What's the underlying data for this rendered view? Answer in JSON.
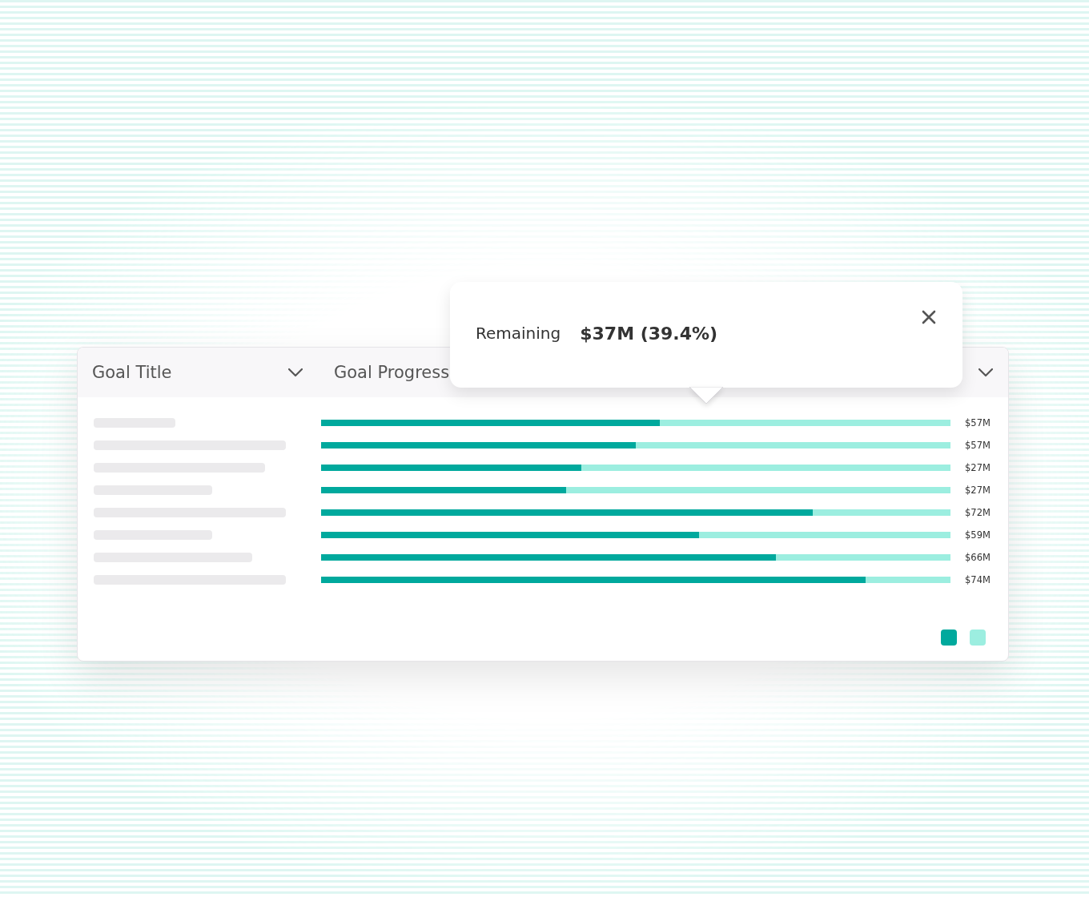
{
  "columns": [
    {
      "label": "Goal Title"
    },
    {
      "label": "Goal Progress"
    }
  ],
  "rows": [
    {
      "value": "$57M",
      "level": 0.538
    },
    {
      "value": "$57M",
      "level": 0.5
    },
    {
      "value": "$27M",
      "level": 0.413
    },
    {
      "value": "$27M",
      "level": 0.389
    },
    {
      "value": "$72M",
      "level": 0.781
    },
    {
      "value": "$59M",
      "level": 0.6
    },
    {
      "value": "$66M",
      "level": 0.723
    },
    {
      "value": "$74M",
      "level": 0.865
    }
  ],
  "legend": [
    {
      "color": "#00a99d"
    },
    {
      "color": "#9ceee0"
    }
  ],
  "tooltip": {
    "label": "Remaining",
    "value": "$37M (39.4%)"
  }
}
